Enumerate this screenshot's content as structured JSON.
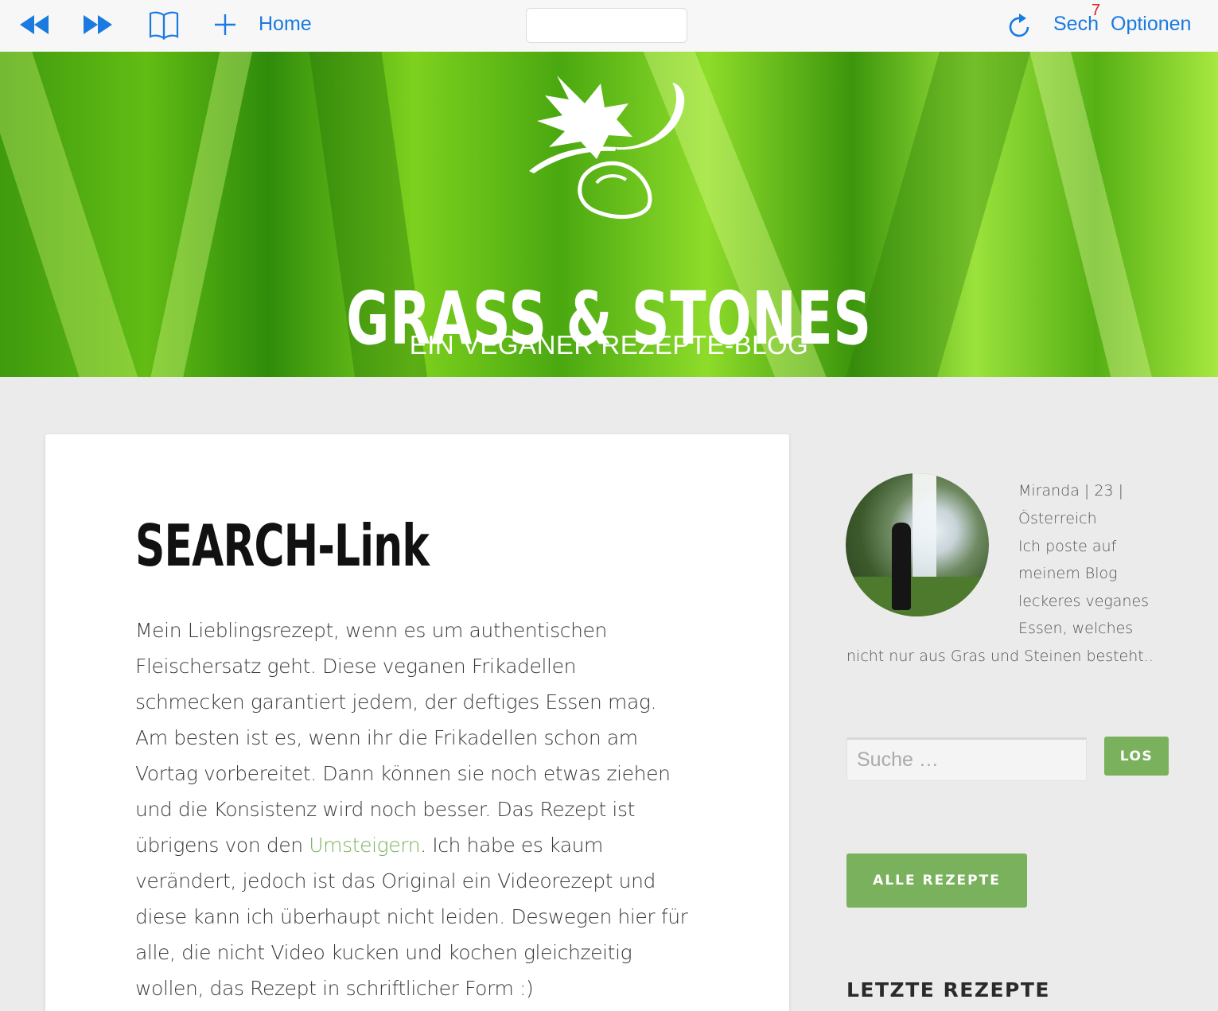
{
  "toolbar": {
    "home_label": "Home",
    "sech_label": "Sech",
    "sech_badge": "7",
    "optionen_label": "Optionen",
    "address_value": "",
    "accent_color": "#1a7ae0"
  },
  "header": {
    "title": "GRASS & STONES",
    "subtitle": "EIN VEGANER REZEPTE-BLOG"
  },
  "post": {
    "title": "SEARCH-Link",
    "lines": [
      "Mein Lieblingsrezept, wenn es um authentischen",
      "Fleischersatz geht. Diese veganen Frikadellen",
      "schmecken garantiert jedem, der deftiges Essen mag.",
      "Am besten ist es, wenn ihr die Frikadellen schon am",
      "Vortag vorbereitet. Dann können sie noch etwas ziehen",
      "und die Konsistenz wird noch besser. Das Rezept ist"
    ],
    "line7_pre": "übrigens von den ",
    "line7_link": "Umsteigern",
    "line7_post": ". Ich habe es kaum",
    "lines_after": [
      "verändert, jedoch ist das Original ein Videorezept und",
      "diese kann ich überhaupt nicht leiden. Deswegen hier für",
      "alle, die nicht Video kucken und kochen gleichzeitig",
      "wollen, das Rezept in schriftlicher Form :)"
    ],
    "link_color": "#7ab15c"
  },
  "sidebar": {
    "bio_lines": [
      "Miranda | 23 |",
      "Österreich",
      "Ich poste auf",
      "meinem Blog",
      "leckeres veganes",
      "Essen, welches",
      "nicht nur aus Gras und Steinen besteht.."
    ],
    "search_placeholder": "Suche …",
    "search_button": "LOS",
    "all_recipes_button": "ALLE REZEPTE",
    "latest_heading": "LETZTE REZEPTE",
    "button_color": "#7ab15c"
  }
}
